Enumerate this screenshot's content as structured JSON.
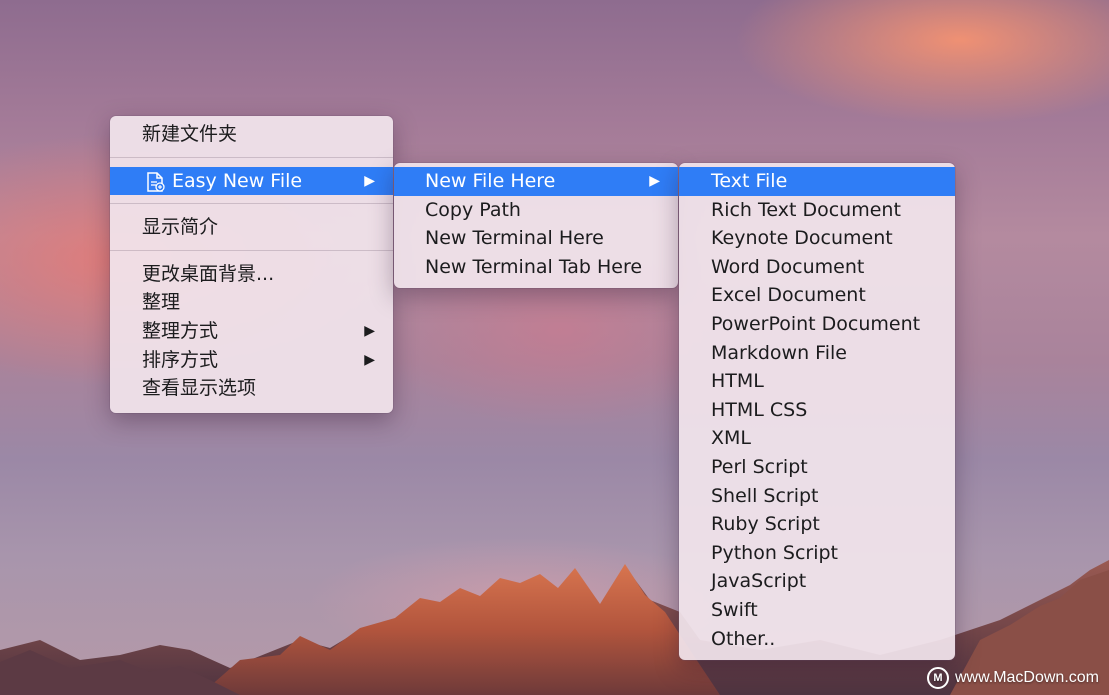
{
  "desktop_menu": {
    "items": [
      {
        "label": "新建文件夹"
      },
      {
        "label": "Easy New File",
        "icon": "new-file-icon",
        "has_submenu": true,
        "selected": true
      },
      {
        "label": "显示简介"
      },
      {
        "label": "更改桌面背景..."
      },
      {
        "label": "整理"
      },
      {
        "label": "整理方式",
        "has_submenu": true
      },
      {
        "label": "排序方式",
        "has_submenu": true
      },
      {
        "label": "查看显示选项"
      }
    ]
  },
  "easy_new_file_menu": {
    "items": [
      {
        "label": "New File Here",
        "has_submenu": true,
        "selected": true
      },
      {
        "label": "Copy Path"
      },
      {
        "label": "New Terminal Here"
      },
      {
        "label": "New Terminal Tab Here"
      }
    ]
  },
  "new_file_menu": {
    "items": [
      {
        "label": "Text File",
        "selected": true
      },
      {
        "label": "Rich Text Document"
      },
      {
        "label": "Keynote Document"
      },
      {
        "label": "Word Document"
      },
      {
        "label": "Excel Document"
      },
      {
        "label": "PowerPoint Document"
      },
      {
        "label": "Markdown File"
      },
      {
        "label": "HTML"
      },
      {
        "label": "HTML CSS"
      },
      {
        "label": "XML"
      },
      {
        "label": "Perl Script"
      },
      {
        "label": "Shell Script"
      },
      {
        "label": "Ruby Script"
      },
      {
        "label": "Python Script"
      },
      {
        "label": "JavaScript"
      },
      {
        "label": "Swift"
      },
      {
        "label": "Other.."
      }
    ]
  },
  "submenu_arrow": "▶",
  "watermark": {
    "logo": "M",
    "text": "www.MacDown.com"
  },
  "colors": {
    "selection": "#2f7df6",
    "menu_background": "#f1e4ec"
  }
}
